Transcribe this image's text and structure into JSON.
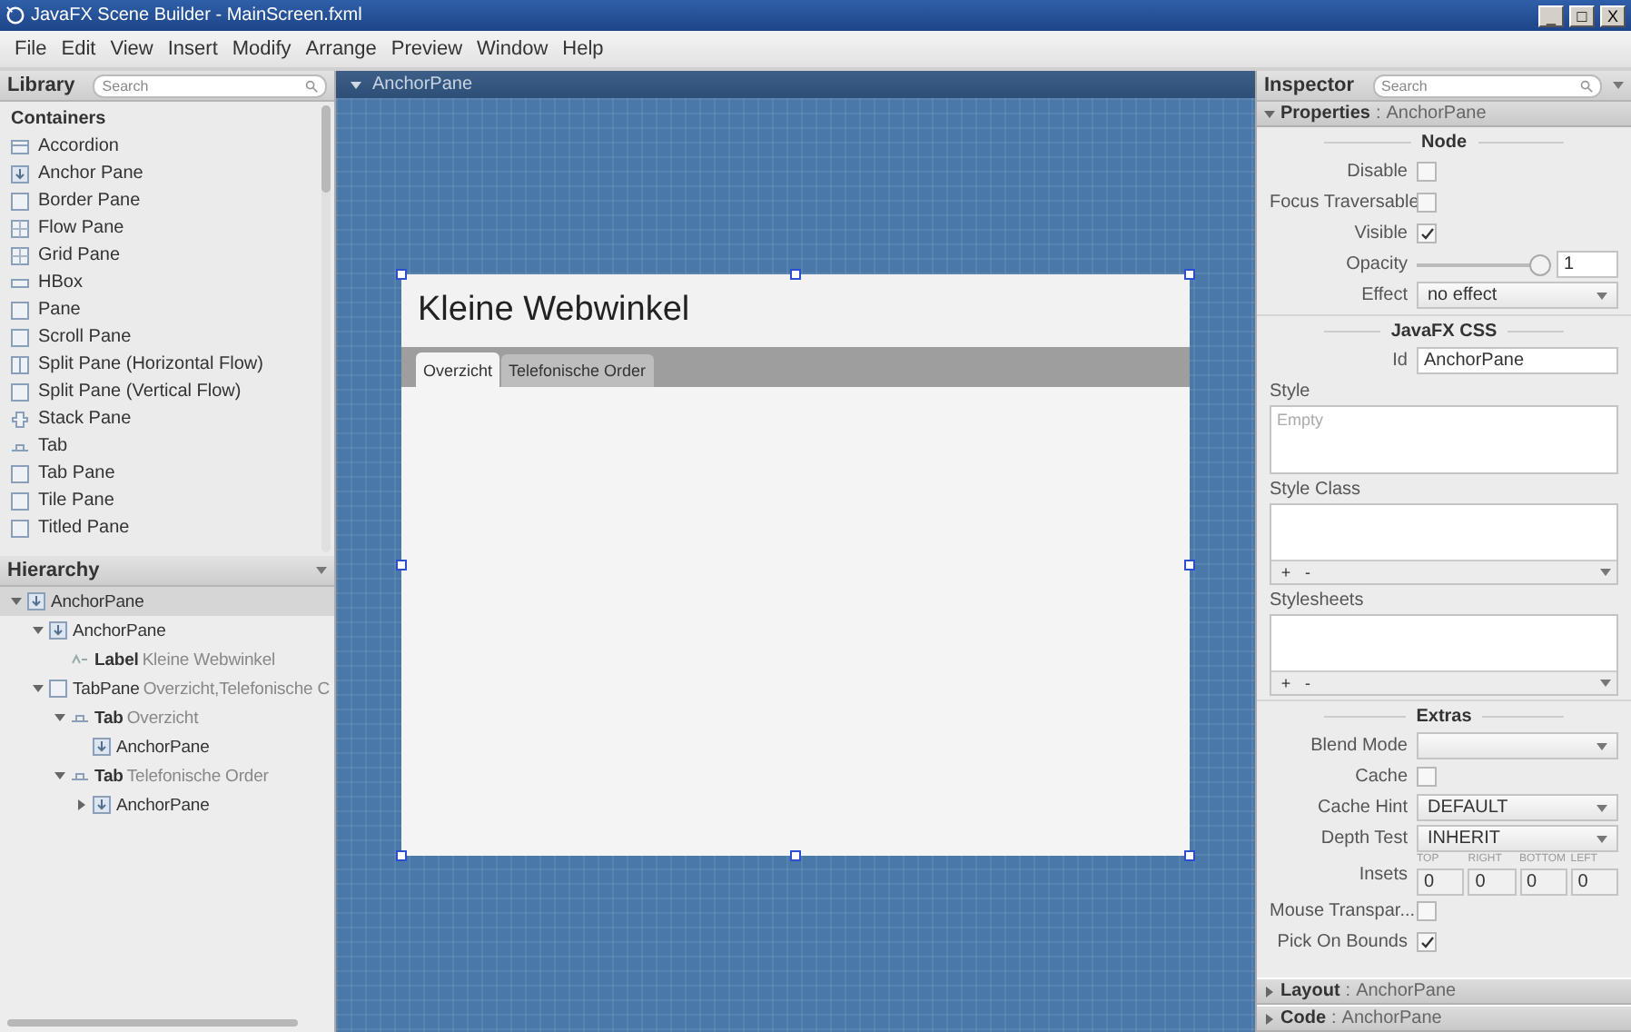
{
  "window": {
    "title": "JavaFX Scene Builder - MainScreen.fxml",
    "controls": [
      "_",
      "□",
      "X"
    ]
  },
  "menu": [
    "File",
    "Edit",
    "View",
    "Insert",
    "Modify",
    "Arrange",
    "Preview",
    "Window",
    "Help"
  ],
  "library": {
    "title": "Library",
    "search_placeholder": "Search",
    "section": "Containers",
    "items": [
      {
        "label": "Accordion",
        "kind": "accordion"
      },
      {
        "label": "Anchor Pane",
        "kind": "anchor"
      },
      {
        "label": "Border Pane",
        "kind": "pane"
      },
      {
        "label": "Flow Pane",
        "kind": "grid"
      },
      {
        "label": "Grid Pane",
        "kind": "grid"
      },
      {
        "label": "HBox",
        "kind": "hbox"
      },
      {
        "label": "Pane",
        "kind": "pane"
      },
      {
        "label": "Scroll Pane",
        "kind": "pane"
      },
      {
        "label": "Split Pane (Horizontal Flow)",
        "kind": "split"
      },
      {
        "label": "Split Pane (Vertical Flow)",
        "kind": "pane"
      },
      {
        "label": "Stack Pane",
        "kind": "stack"
      },
      {
        "label": "Tab",
        "kind": "tab"
      },
      {
        "label": "Tab Pane",
        "kind": "pane"
      },
      {
        "label": "Tile Pane",
        "kind": "pane"
      },
      {
        "label": "Titled Pane",
        "kind": "pane"
      }
    ]
  },
  "hierarchy": {
    "title": "Hierarchy",
    "items": [
      {
        "type": "AnchorPane",
        "kind": "anchor",
        "expanded": true,
        "selected": true,
        "children": [
          {
            "type": "AnchorPane",
            "kind": "anchor",
            "expanded": true,
            "selected": false,
            "children": [
              {
                "type": "Label",
                "detail": "Kleine Webwinkel",
                "kind": "label",
                "selected": false
              }
            ]
          },
          {
            "type": "TabPane",
            "detail": "Overzicht,Telefonische C",
            "kind": "pane",
            "expanded": true,
            "selected": false,
            "children": [
              {
                "type": "Tab",
                "detail": "Overzicht",
                "kind": "tab",
                "expanded": true,
                "selected": false,
                "children": [
                  {
                    "type": "AnchorPane",
                    "kind": "anchor",
                    "selected": false
                  }
                ]
              },
              {
                "type": "Tab",
                "detail": "Telefonische Order",
                "kind": "tab",
                "expanded": true,
                "selected": false,
                "children": [
                  {
                    "type": "AnchorPane",
                    "kind": "anchor",
                    "expanded": false,
                    "selected": false
                  }
                ]
              }
            ]
          }
        ]
      }
    ]
  },
  "canvas": {
    "breadcrumb": "AnchorPane",
    "form": {
      "heading": "Kleine Webwinkel",
      "tabs": [
        {
          "label": "Overzicht",
          "selected": true
        },
        {
          "label": "Telefonische Order",
          "selected": false
        }
      ]
    }
  },
  "inspector": {
    "title": "Inspector",
    "search_placeholder": "Search",
    "properties": {
      "title": "Properties",
      "separator": ":",
      "target": "AnchorPane",
      "expanded": true
    },
    "node": {
      "title": "Node",
      "rows": [
        {
          "kind": "checkbox",
          "label": "Disable",
          "checked": false
        },
        {
          "kind": "checkbox",
          "label": "Focus Traversable",
          "checked": false
        },
        {
          "kind": "checkbox",
          "label": "Visible",
          "checked": true
        },
        {
          "kind": "slider",
          "label": "Opacity",
          "level": 1,
          "value": "1"
        },
        {
          "kind": "select",
          "label": "Effect",
          "value": "no effect"
        }
      ]
    },
    "css": {
      "title": "JavaFX CSS",
      "id_label": "Id",
      "id_value": "AnchorPane",
      "style_label": "Style",
      "style_placeholder": "Empty",
      "style_class_label": "Style Class",
      "stylesheets_label": "Stylesheets",
      "add": "+",
      "remove": "-"
    },
    "extras": {
      "title": "Extras",
      "rows": [
        {
          "kind": "select",
          "label": "Blend Mode",
          "value": ""
        },
        {
          "kind": "checkbox",
          "label": "Cache",
          "checked": false
        },
        {
          "kind": "select",
          "label": "Cache Hint",
          "value": "DEFAULT"
        },
        {
          "kind": "select",
          "label": "Depth Test",
          "value": "INHERIT"
        },
        {
          "kind": "insets",
          "label": "Insets",
          "fields": [
            {
              "caption": "TOP",
              "value": "0"
            },
            {
              "caption": "RIGHT",
              "value": "0"
            },
            {
              "caption": "BOTTOM",
              "value": "0"
            },
            {
              "caption": "LEFT",
              "value": "0"
            }
          ]
        },
        {
          "kind": "checkbox",
          "label": "Mouse Transpar...",
          "checked": false
        },
        {
          "kind": "checkbox",
          "label": "Pick On Bounds",
          "checked": true
        }
      ]
    },
    "sections": [
      {
        "title": "Layout",
        "separator": ":",
        "target": "AnchorPane",
        "expanded": false
      },
      {
        "title": "Code",
        "separator": ":",
        "target": "AnchorPane",
        "expanded": false
      }
    ]
  }
}
